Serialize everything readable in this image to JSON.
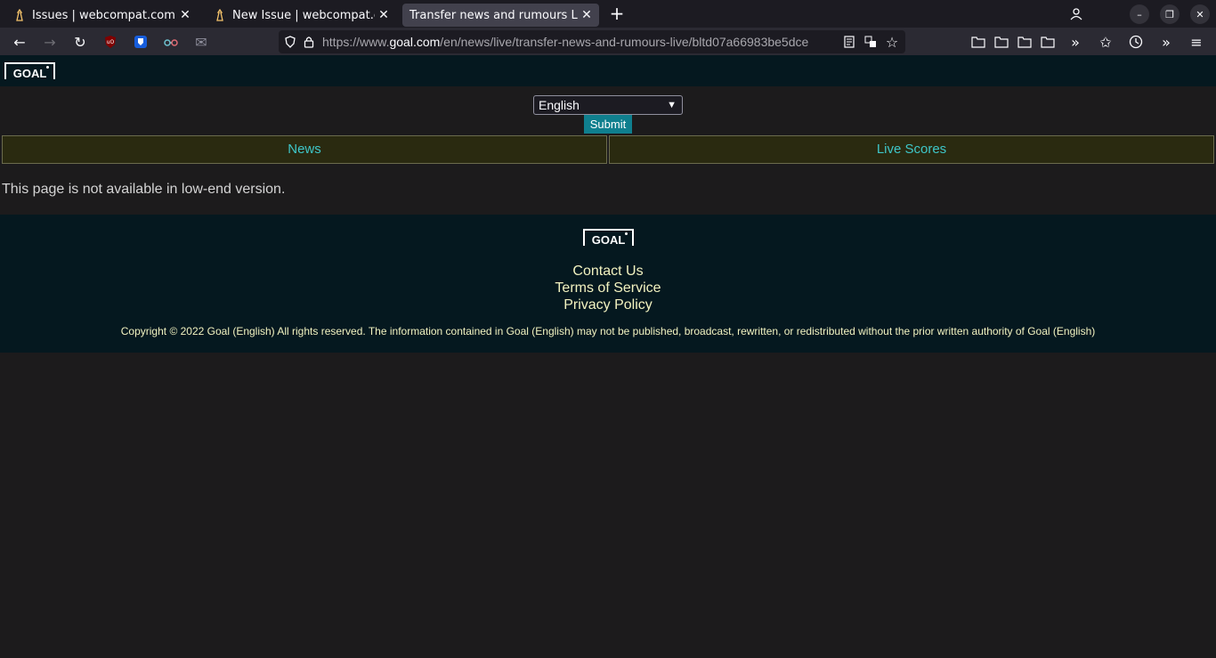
{
  "browser": {
    "tabs": [
      {
        "title": "Issues | webcompat.com",
        "favicon": "webcompat-icon",
        "active": false
      },
      {
        "title": "New Issue | webcompat.com",
        "favicon": "webcompat-icon",
        "active": false
      },
      {
        "title": "Transfer news and rumours LIVE",
        "favicon": "none",
        "active": true
      }
    ],
    "url_prefix": "https://www.",
    "url_domain": "goal.com",
    "url_path": "/en/news/live/transfer-news-and-rumours-live/bltd07a66983be5dce",
    "accent": "#42414d"
  },
  "site": {
    "logo_text": "GOAL",
    "language_selected": "English",
    "submit_label": "Submit",
    "nav": {
      "news": "News",
      "live_scores": "Live Scores"
    },
    "notice": "This page is not available in low-end version.",
    "footer": {
      "logo_text": "GOAL",
      "contact": "Contact Us",
      "terms": "Terms of Service",
      "privacy": "Privacy Policy",
      "copyright": "Copyright © 2022 Goal (English) All rights reserved. The information contained in Goal (English) may not be published, broadcast, rewritten, or redistributed without the prior written authority of Goal (English)"
    },
    "colors": {
      "header_bg": "#05181f",
      "link": "#3ec6c8",
      "footer_text": "#f2f2c0",
      "button": "#0f7f8e"
    }
  }
}
